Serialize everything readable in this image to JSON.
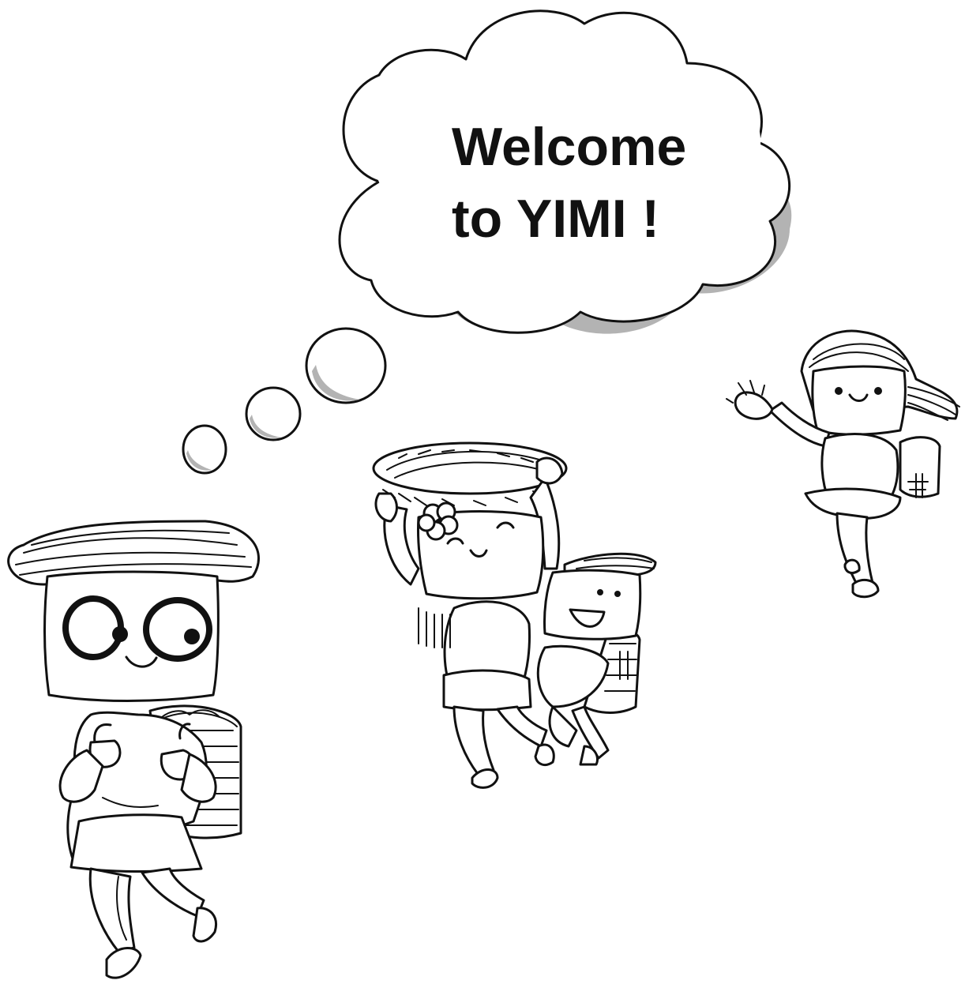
{
  "speech_bubble": {
    "line1": "Welcome",
    "line2": "to YIMI !"
  },
  "colors": {
    "ink": "#111111",
    "paper": "#ffffff",
    "bubble_shadow": "#b3b3b3"
  }
}
